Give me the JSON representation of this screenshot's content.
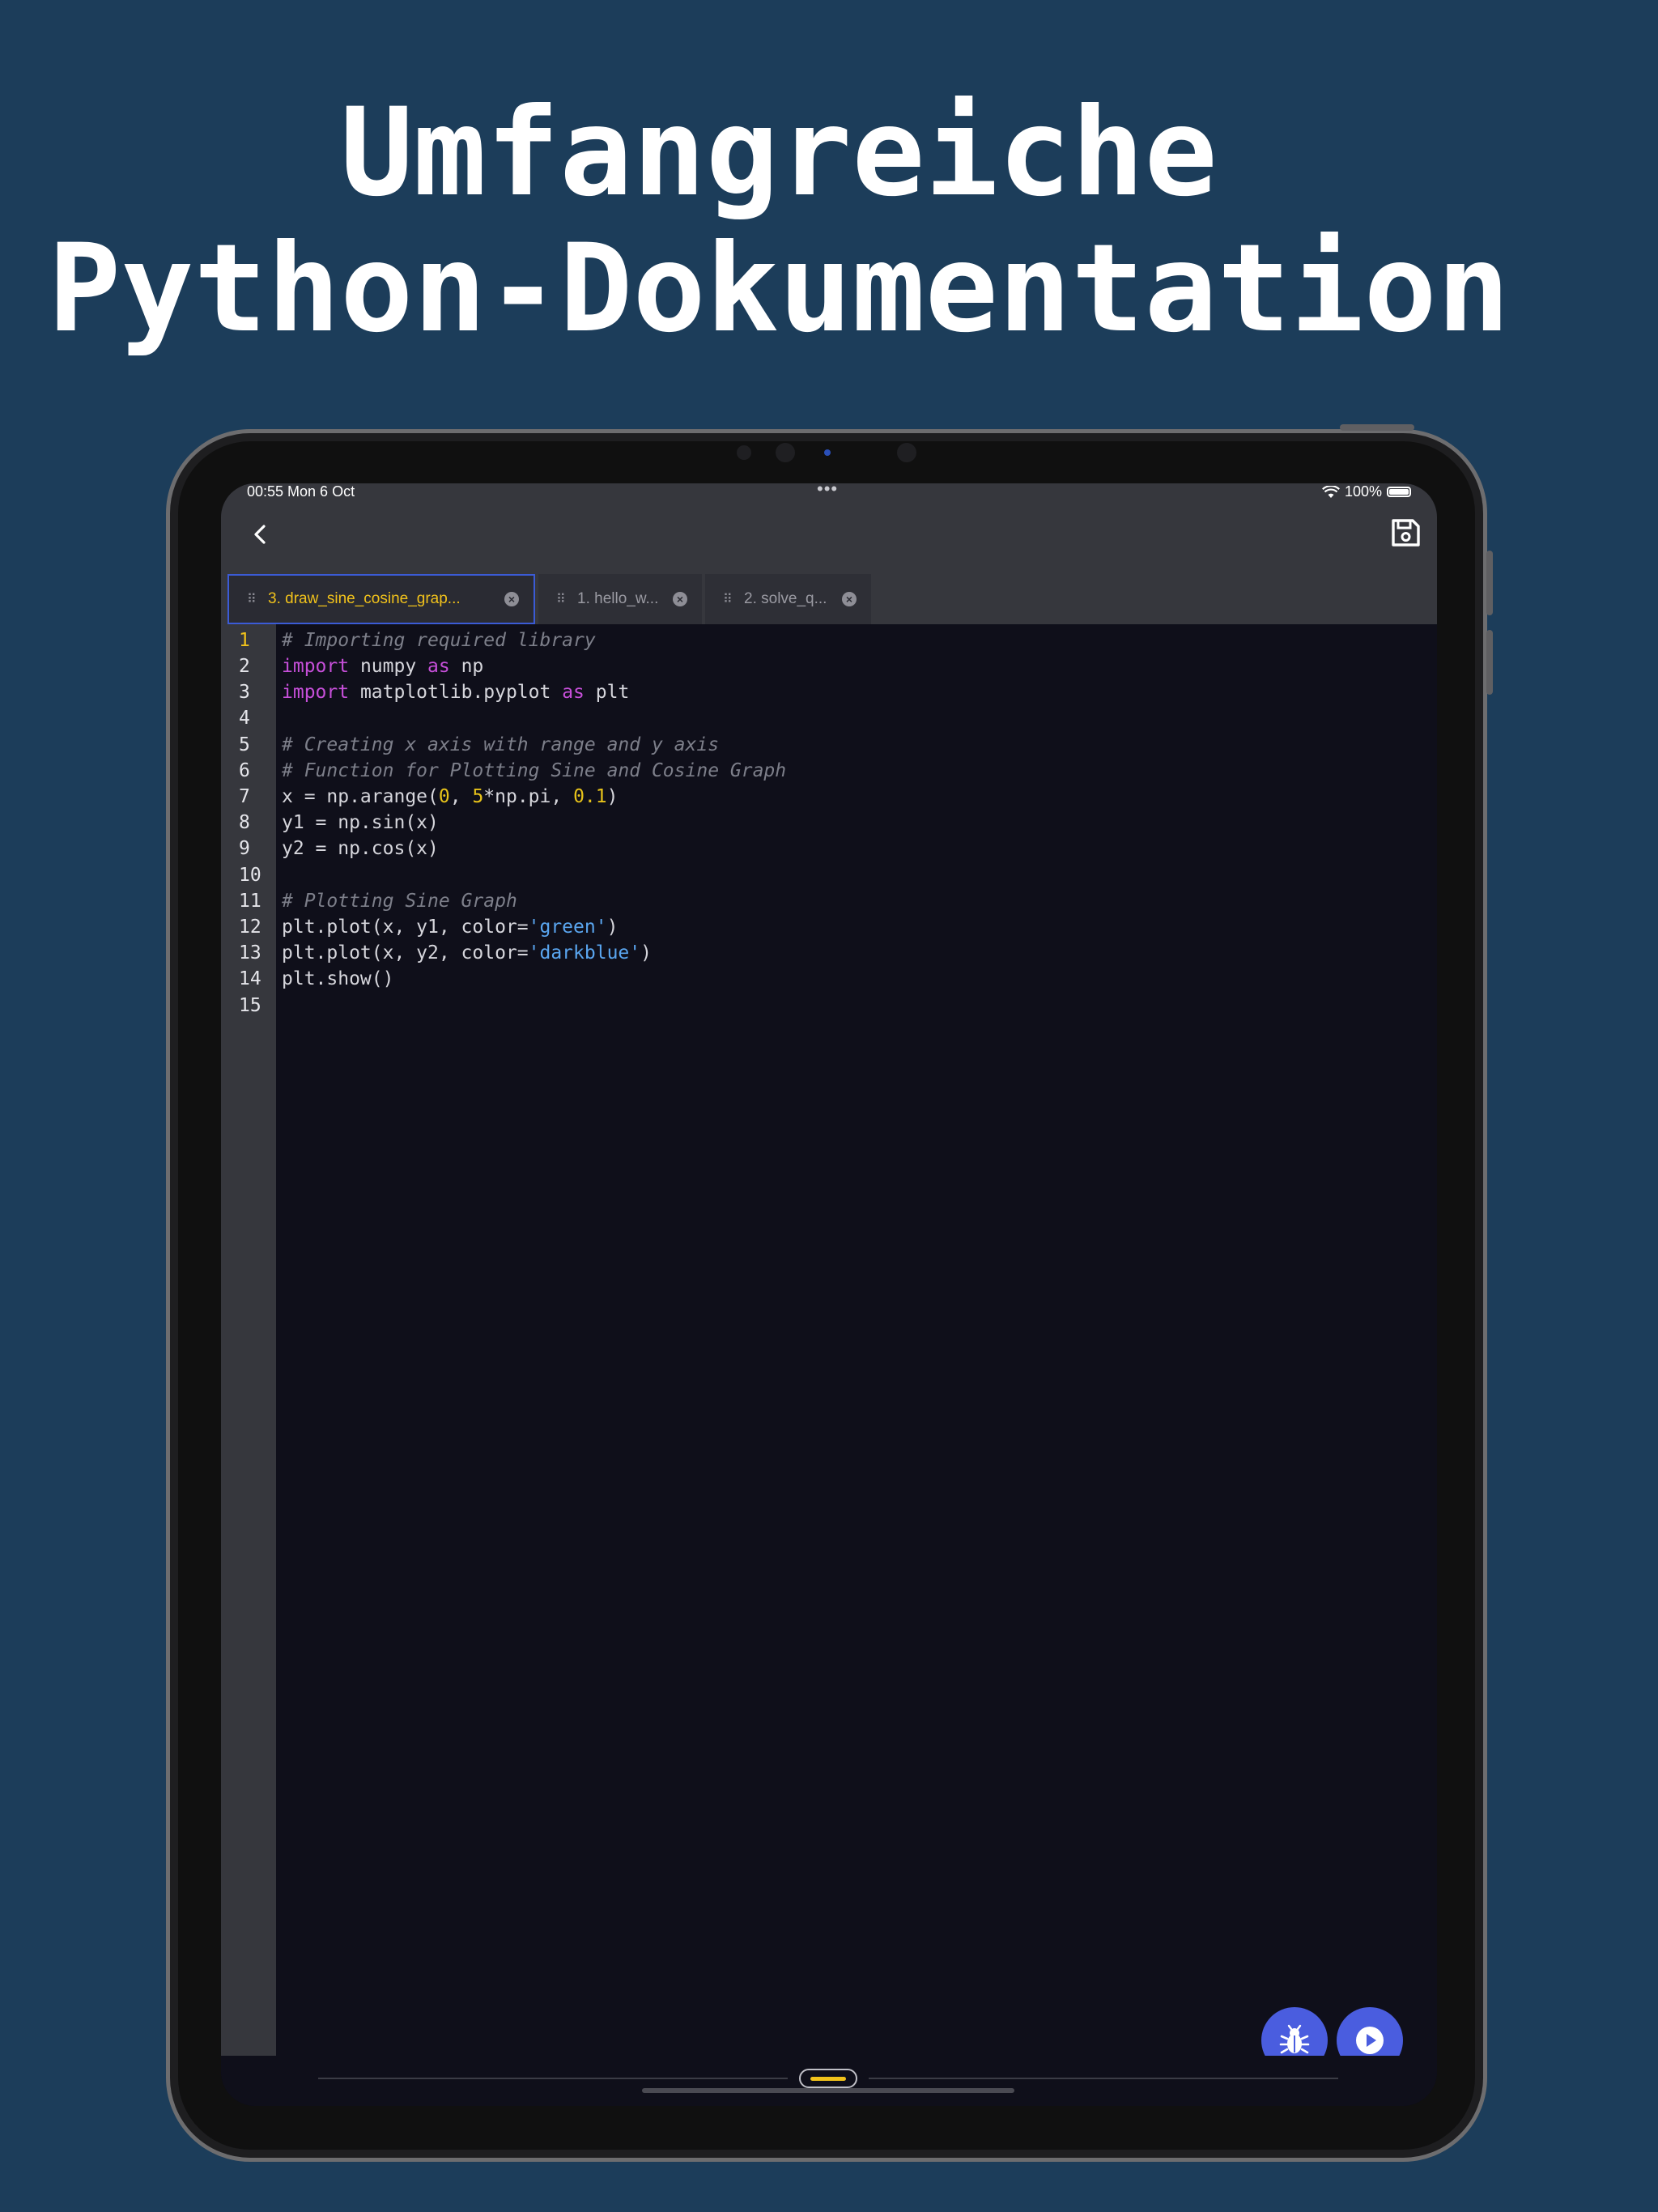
{
  "headline": {
    "line1": "Umfangreiche",
    "line2": "Python-Dokumentation"
  },
  "status_bar": {
    "time_date": "00:55  Mon 6 Oct",
    "dots": "•••",
    "battery": "100%"
  },
  "toolbar": {
    "back_icon": "chevron-left-icon",
    "save_icon": "save-icon"
  },
  "tabs": [
    {
      "label": "3. draw_sine_cosine_grap...",
      "active": true
    },
    {
      "label": "1. hello_w...",
      "active": false
    },
    {
      "label": "2. solve_q...",
      "active": false
    }
  ],
  "editor": {
    "line_numbers": [
      "1",
      "2",
      "3",
      "4",
      "5",
      "6",
      "7",
      "8",
      "9",
      "10",
      "11",
      "12",
      "13",
      "14",
      "15"
    ],
    "current_line": 1,
    "code": [
      "# Importing required library",
      "import numpy as np",
      "import matplotlib.pyplot as plt",
      "",
      "# Creating x axis with range and y axis",
      "# Function for Plotting Sine and Cosine Graph",
      "x = np.arange(0, 5*np.pi, 0.1)",
      "y1 = np.sin(x)",
      "y2 = np.cos(x)",
      "",
      "# Plotting Sine Graph",
      "plt.plot(x, y1, color='green')",
      "plt.plot(x, y2, color='darkblue')",
      "plt.show()",
      ""
    ]
  },
  "actions": {
    "debug_icon": "bug-icon",
    "run_icon": "play-icon"
  },
  "colors": {
    "background": "#1c3d5a",
    "accent": "#4a5ddf",
    "active_tab": "#f1c21b",
    "keyword": "#c64fd9",
    "string": "#5aa6f0",
    "number": "#e8c31a"
  }
}
